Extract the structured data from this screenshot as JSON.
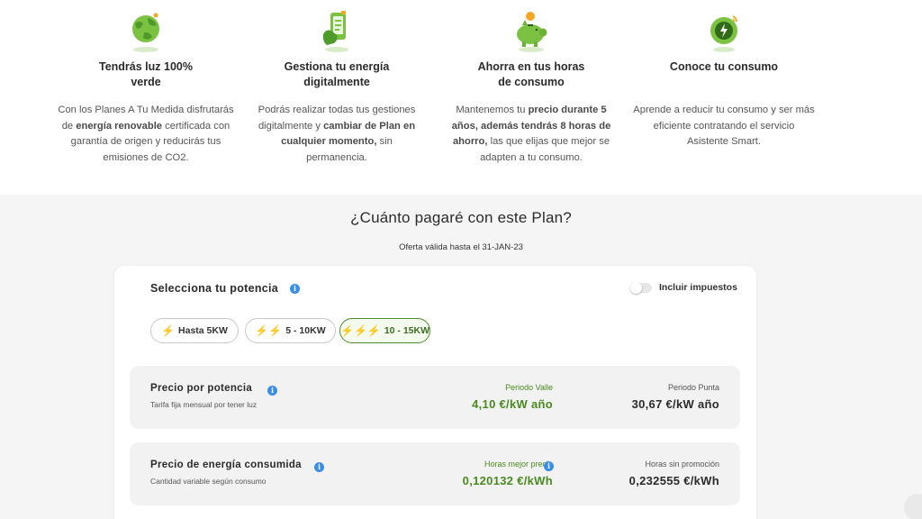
{
  "features": [
    {
      "icon": "globe-icon",
      "title_line1": "Tendrás luz 100%",
      "title_line2": "verde",
      "desc": [
        [
          {
            "t": "Con los Planes A Tu Medida disfrutarás",
            "b": false
          }
        ],
        [
          {
            "t": "de ",
            "b": false
          },
          {
            "t": "energía renovable",
            "b": true
          },
          {
            "t": " certificada con",
            "b": false
          }
        ],
        [
          {
            "t": "garantía de origen y reducirás tus",
            "b": false
          }
        ],
        [
          {
            "t": "emisiones de CO2.",
            "b": false
          }
        ]
      ]
    },
    {
      "icon": "phone-hand-icon",
      "title_line1": "Gestiona tu energía",
      "title_line2": "digitalmente",
      "desc": [
        [
          {
            "t": "Podrás realizar todas tus gestiones",
            "b": false
          }
        ],
        [
          {
            "t": "digitalmente y ",
            "b": false
          },
          {
            "t": "cambiar de Plan en",
            "b": true
          }
        ],
        [
          {
            "t": "cualquier momento,",
            "b": true
          },
          {
            "t": " sin",
            "b": false
          }
        ],
        [
          {
            "t": "permanencia.",
            "b": false
          }
        ]
      ]
    },
    {
      "icon": "piggy-bank-icon",
      "title_line1": "Ahorra en tus horas",
      "title_line2": "de consumo",
      "desc": [
        [
          {
            "t": "Mantenemos tu ",
            "b": false
          },
          {
            "t": "precio durante 5",
            "b": true
          }
        ],
        [
          {
            "t": "años, además tendrás 8 horas de",
            "b": true
          }
        ],
        [
          {
            "t": "ahorro,",
            "b": true
          },
          {
            "t": " las que elijas que mejor se",
            "b": false
          }
        ],
        [
          {
            "t": "adapten a tu consumo.",
            "b": false
          }
        ]
      ]
    },
    {
      "icon": "smart-meter-icon",
      "title_line1": "Conoce tu consumo",
      "title_line2": "",
      "desc": [
        [
          {
            "t": "Aprende a reducir tu consumo y ser más",
            "b": false
          }
        ],
        [
          {
            "t": "eficiente contratando el servicio",
            "b": false
          }
        ],
        [
          {
            "t": "Asistente Smart.",
            "b": false
          }
        ]
      ]
    }
  ],
  "pricing": {
    "heading": "¿Cuánto pagaré con este Plan?",
    "offer": "Oferta válida hasta el 31-JAN-23",
    "select_label": "Selecciona tu potencia",
    "taxes_toggle_label": "Incluir impuestos",
    "taxes_toggle_on": false,
    "power_options": [
      {
        "label": "Hasta 5KW",
        "bolts": 1,
        "selected": false
      },
      {
        "label": "5 - 10KW",
        "bolts": 2,
        "selected": false
      },
      {
        "label": "10 - 15KW",
        "bolts": 3,
        "selected": true
      }
    ],
    "rows": [
      {
        "title": "Precio por potencia",
        "subtitle": "Tarifa fija mensual por tener luz",
        "col1_label": "Periodo Valle",
        "col1_value": "4,10 €/kW año",
        "col2_label": "Periodo Punta",
        "col2_value": "30,67 €/kW año"
      },
      {
        "title": "Precio de energía consumida",
        "subtitle": "Cantidad variable según consumo",
        "col1_label": "Horas mejor precio",
        "col1_value": "0,120132 €/kWh",
        "col2_label": "Horas sin promoción",
        "col2_value": "0,232555 €/kWh"
      }
    ]
  },
  "colors": {
    "accent_green": "#4a8a1f",
    "info_blue": "#3a8ee6",
    "bolt_orange": "#f5a623",
    "page_bg": "#f5f5f5"
  }
}
